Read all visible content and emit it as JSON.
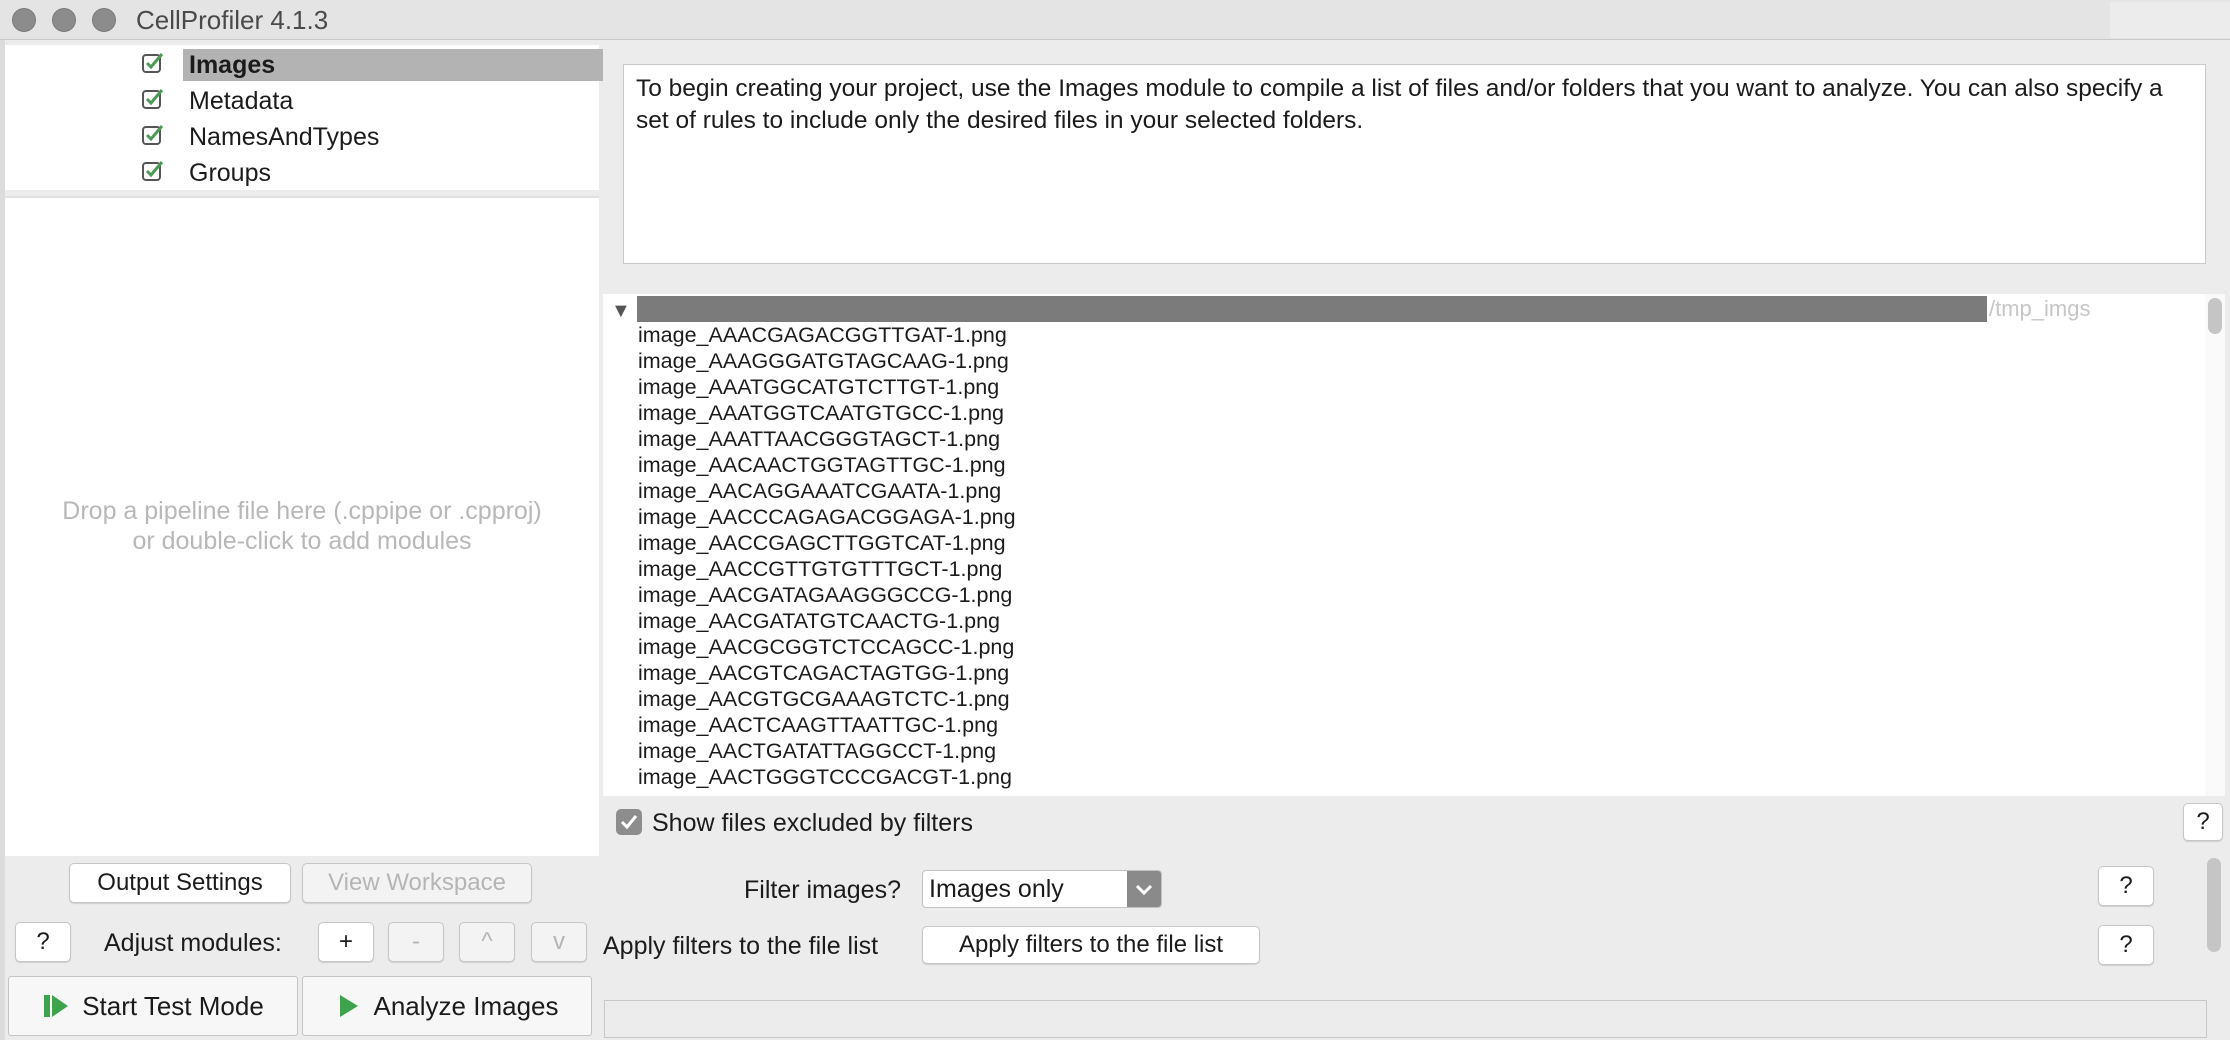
{
  "window": {
    "title": "CellProfiler 4.1.3"
  },
  "modules": [
    {
      "label": "Images",
      "selected": true
    },
    {
      "label": "Metadata",
      "selected": false
    },
    {
      "label": "NamesAndTypes",
      "selected": false
    },
    {
      "label": "Groups",
      "selected": false
    }
  ],
  "pipeline": {
    "drop_hint_line1": "Drop a pipeline file here (.cppipe or .cpproj)",
    "drop_hint_line2": "or double-click to add modules"
  },
  "left_controls": {
    "output_settings": "Output Settings",
    "view_workspace": "View Workspace",
    "help": "?",
    "adjust_label": "Adjust modules:",
    "add": "+",
    "remove": "-",
    "up": "^",
    "down": "v",
    "start_test_mode": "Start Test Mode",
    "analyze_images": "Analyze Images"
  },
  "help_text": "To begin creating your project, use the Images module to compile a list of files and/or folders that you want to analyze. You can also specify a set of rules to include only the desired files in your selected folders.",
  "file_tree": {
    "root_label": "/tmp_imgs",
    "files": [
      "image_AAACGAGACGGTTGAT-1.png",
      "image_AAAGGGATGTAGCAAG-1.png",
      "image_AAATGGCATGTCTTGT-1.png",
      "image_AAATGGTCAATGTGCC-1.png",
      "image_AAATTAACGGGTAGCT-1.png",
      "image_AACAACTGGTAGTTGC-1.png",
      "image_AACAGGAAATCGAATA-1.png",
      "image_AACCCAGAGACGGAGA-1.png",
      "image_AACCGAGCTTGGTCAT-1.png",
      "image_AACCGTTGTGTTTGCT-1.png",
      "image_AACGATAGAAGGGCCG-1.png",
      "image_AACGATATGTCAACTG-1.png",
      "image_AACGCGGTCTCCAGCC-1.png",
      "image_AACGTCAGACTAGTGG-1.png",
      "image_AACGTGCGAAAGTCTC-1.png",
      "image_AACTCAAGTTAATTGC-1.png",
      "image_AACTGATATTAGGCCT-1.png",
      "image_AACTGGGTCCCGACGT-1.png"
    ]
  },
  "settings": {
    "show_excluded_label": "Show files excluded by filters",
    "show_excluded_checked": true,
    "filter_label": "Filter images?",
    "filter_value": "Images only",
    "apply_label": "Apply filters to the file list",
    "apply_button": "Apply filters to the file list",
    "help": "?"
  },
  "colors": {
    "selected_row": "#b3b3b3",
    "checkmark": "#6b8e6b",
    "play_green": "#3fa34d"
  }
}
